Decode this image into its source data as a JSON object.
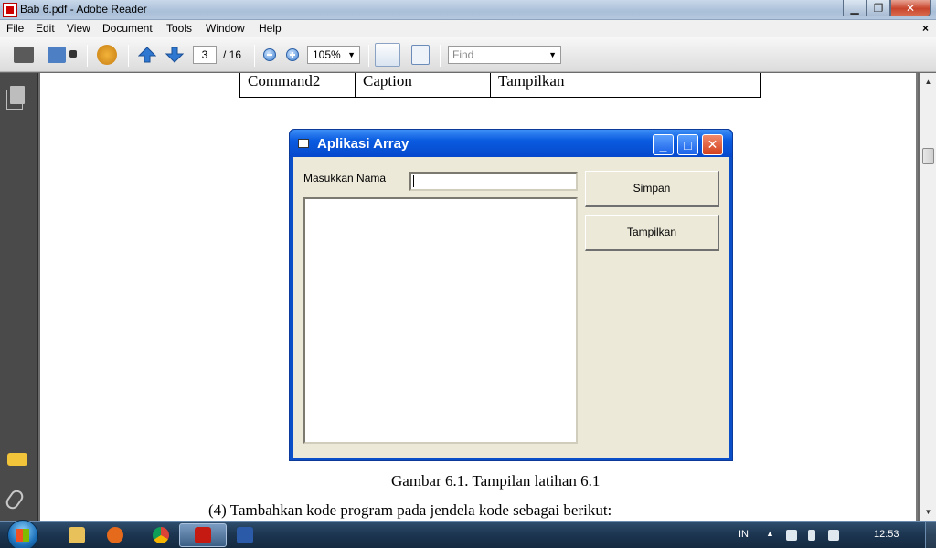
{
  "window": {
    "title": "Bab 6.pdf - Adobe Reader",
    "min_glyph": "▁",
    "max_glyph": "❐",
    "close_glyph": "✕"
  },
  "menu": {
    "items": [
      "File",
      "Edit",
      "View",
      "Document",
      "Tools",
      "Window",
      "Help"
    ],
    "close_glyph": "×"
  },
  "toolbar": {
    "page_current": "3",
    "page_total": "/ 16",
    "zoom": "105%",
    "zoom_caret": "▼",
    "find_placeholder": "Find",
    "find_caret": "▼"
  },
  "document": {
    "table_row": [
      "Command2",
      "Caption",
      "Tampilkan"
    ],
    "figure_caption": "Gambar 6.1. Tampilan latihan 6.1",
    "paragraph": "(4)  Tambahkan kode program pada jendela kode sebagai berikut:",
    "vb_form": {
      "title": "Aplikasi Array",
      "label": "Masukkan Nama",
      "button_save": "Simpan",
      "button_show": "Tampilkan",
      "min_glyph": "_",
      "max_glyph": "□",
      "close_glyph": "✕"
    }
  },
  "scrollbar": {
    "up_glyph": "▲",
    "down_glyph": "▼"
  },
  "taskbar": {
    "language": "IN",
    "clock": "12:53",
    "apps": [
      {
        "name": "explorer",
        "color": "#e8c15a"
      },
      {
        "name": "firefox",
        "color": "#e66a1c"
      },
      {
        "name": "chrome",
        "color": "#3ca64a"
      },
      {
        "name": "adobe-reader",
        "color": "#c41a12"
      },
      {
        "name": "word",
        "color": "#2a5aa8"
      }
    ]
  }
}
